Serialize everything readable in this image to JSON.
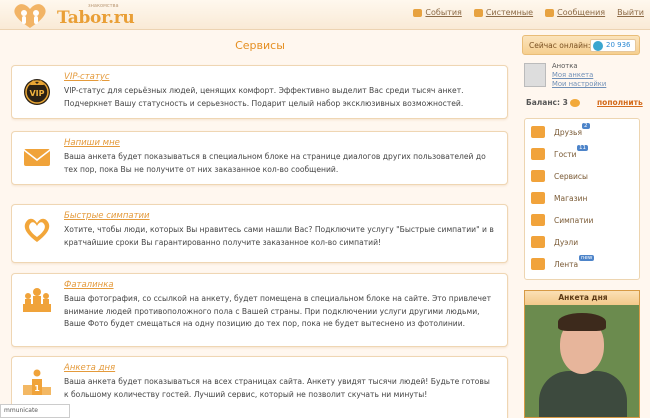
{
  "brand": {
    "name": "Tabor.ru",
    "tagline": "знакомства"
  },
  "topnav": [
    {
      "label": "События",
      "icon": "bell-icon"
    },
    {
      "label": "Системные",
      "icon": "lock-icon"
    },
    {
      "label": "Сообщения",
      "icon": "envelope-icon"
    },
    {
      "label": "Выйти",
      "icon": "exit-icon"
    }
  ],
  "page_title": "Сервисы",
  "services": [
    {
      "title": "VIP-статус",
      "icon": "vip-badge-icon",
      "text": "VIP-статус для серьёзных людей, ценящих комфорт. Эффективно выделит Вас среди тысяч анкет. Подчеркнет Вашу статусность и серьезность. Подарит целый набор эксклюзивных возможностей."
    },
    {
      "title": "Напиши мне",
      "icon": "envelope-icon",
      "text": "Ваша анкета будет показываться в специальном блоке на странице диалогов других пользователей до тех пор, пока Вы не получите от них заказанное кол-во сообщений."
    },
    {
      "title": "Быстрые симпатии",
      "icon": "heart-icon",
      "text": "Хотите, чтобы люди, которых Вы нравитесь сами нашли Вас? Подключите услугу \"Быстрые симпатии\" и в кратчайшие сроки Вы гарантированно получите заказанное кол-во симпатий!"
    },
    {
      "title": "Фаталинка",
      "icon": "crowd-icon",
      "text": "Ваша фотография, со ссылкой на анкету, будет помещена в специальном блоке на сайте. Это привлечет внимание людей противоположного пола с Вашей страны. При подключении услуги другими людьми, Ваше Фото будет смещаться на одну позицию до тех пор, пока не будет вытеснено из фотолинии."
    },
    {
      "title": "Анкета дня",
      "icon": "podium-icon",
      "text": "Ваша анкета будет показываться на всех страницах сайта. Анкету увидят тысячи людей! Будьте готовы к большому количеству гостей. Лучший сервис, который не позволит скучать ни минуты!"
    }
  ],
  "sidebar": {
    "online_label": "Сейчас онлайн:",
    "online_count": "20 936",
    "user": {
      "name": "Анотка",
      "link1": "Моя анкета",
      "link2": "Мои настройки"
    },
    "balance_label": "Баланс:",
    "balance_value": "3",
    "topup_label": "пополнить",
    "menu": [
      {
        "label": "Друзья",
        "icon": "friends-icon",
        "badge": "2"
      },
      {
        "label": "Гости",
        "icon": "guests-icon",
        "badge": "11"
      },
      {
        "label": "Сервисы",
        "icon": "services-icon",
        "badge": ""
      },
      {
        "label": "Магазин",
        "icon": "shop-icon",
        "badge": ""
      },
      {
        "label": "Симпатии",
        "icon": "heart-icon",
        "badge": ""
      },
      {
        "label": "Дуэли",
        "icon": "swords-icon",
        "badge": ""
      },
      {
        "label": "Лента",
        "icon": "feed-icon",
        "badge": "new"
      }
    ],
    "day_title": "Анкета дня"
  },
  "status_bar": "mmunicate"
}
